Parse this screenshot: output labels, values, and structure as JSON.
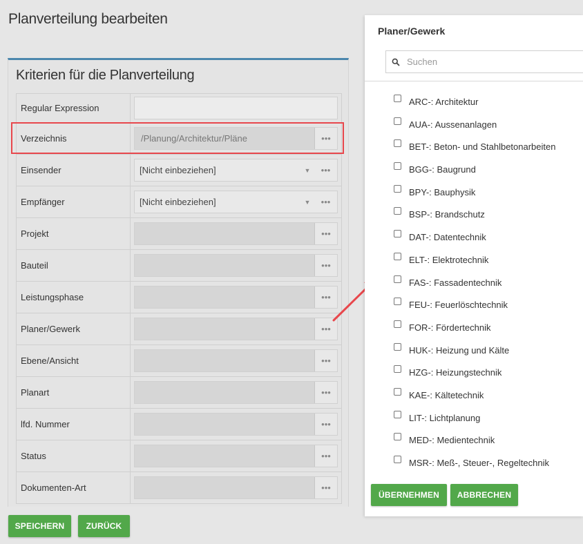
{
  "page": {
    "title": "Planverteilung bearbeiten"
  },
  "criteria": {
    "title": "Kriterien für die Planverteilung",
    "rows": [
      {
        "label": "Regular Expression",
        "kind": "text",
        "value": ""
      },
      {
        "label": "Verzeichnis",
        "kind": "lookup",
        "value": "/Planung/Architektur/Pläne"
      },
      {
        "label": "Einsender",
        "kind": "select",
        "value": "[Nicht einbeziehen]"
      },
      {
        "label": "Empfänger",
        "kind": "select",
        "value": "[Nicht einbeziehen]"
      },
      {
        "label": "Projekt",
        "kind": "lookup",
        "value": ""
      },
      {
        "label": "Bauteil",
        "kind": "lookup",
        "value": ""
      },
      {
        "label": "Leistungsphase",
        "kind": "lookup",
        "value": ""
      },
      {
        "label": "Planer/Gewerk",
        "kind": "lookup",
        "value": ""
      },
      {
        "label": "Ebene/Ansicht",
        "kind": "lookup",
        "value": ""
      },
      {
        "label": "Planart",
        "kind": "lookup",
        "value": ""
      },
      {
        "label": "lfd. Nummer",
        "kind": "lookup",
        "value": ""
      },
      {
        "label": "Status",
        "kind": "lookup",
        "value": ""
      },
      {
        "label": "Dokumenten-Art",
        "kind": "lookup",
        "value": ""
      }
    ],
    "more_glyph": "•••"
  },
  "buttons": {
    "save": "SPEICHERN",
    "back": "ZURÜCK"
  },
  "dialog": {
    "title": "Planer/Gewerk",
    "search_placeholder": "Suchen",
    "options": [
      "ARC-: Architektur",
      "AUA-: Aussenanlagen",
      "BET-: Beton- und Stahlbetonarbeiten",
      "BGG-: Baugrund",
      "BPY-: Bauphysik",
      "BSP-: Brandschutz",
      "DAT-: Datentechnik",
      "ELT-: Elektrotechnik",
      "FAS-: Fassadentechnik",
      "FEU-: Feuerlöschtechnik",
      "FOR-: Fördertechnik",
      "HUK-: Heizung und Kälte",
      "HZG-: Heizungstechnik",
      "KAE-: Kältetechnik",
      "LIT-: Lichtplanung",
      "MED-: Medientechnik",
      "MSR-: Meß-, Steuer-, Regeltechnik"
    ],
    "apply": "ÜBERNEHMEN",
    "cancel": "ABBRECHEN"
  },
  "colors": {
    "accent": "#4b87ad",
    "button": "#52a84a",
    "highlight": "#e8474c"
  }
}
